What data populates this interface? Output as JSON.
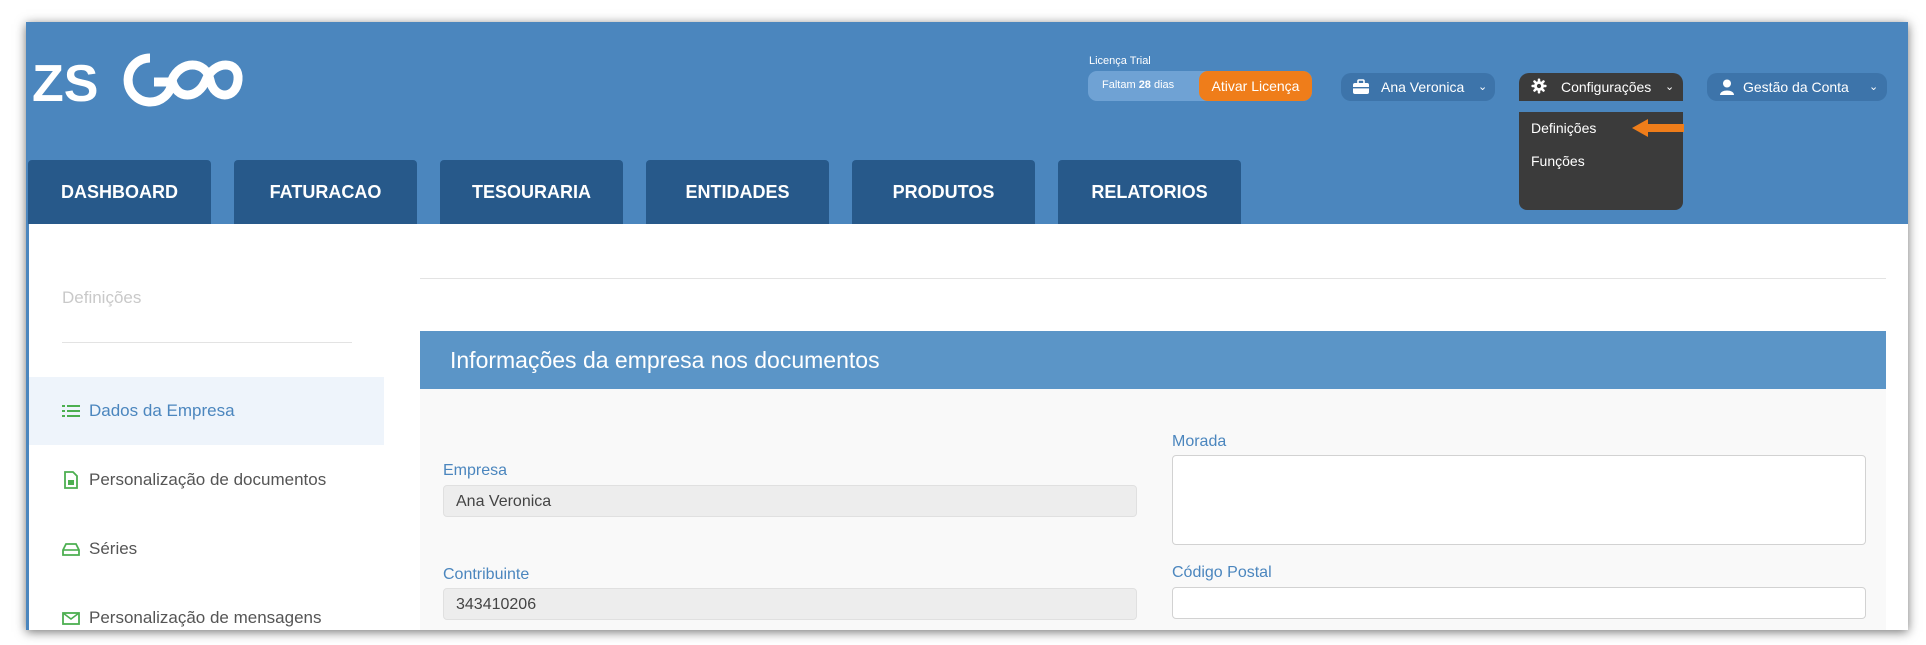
{
  "app": {
    "logo_text": "ZS GO",
    "license": {
      "label": "Licença Trial",
      "days_prefix": "Faltam",
      "days_value": "28",
      "days_suffix": "dias",
      "activate_button": "Ativar Licença"
    },
    "company_menu": {
      "label": "Ana Veronica",
      "icon": "briefcase-icon"
    },
    "config_menu": {
      "label": "Configurações",
      "icon": "gear-icon",
      "items": [
        "Definições",
        "Funções"
      ]
    },
    "account_menu": {
      "label": "Gestão da Conta",
      "icon": "user-icon"
    }
  },
  "nav": {
    "tabs": [
      "DASHBOARD",
      "FATURACAO",
      "TESOURARIA",
      "ENTIDADES",
      "PRODUTOS",
      "RELATORIOS"
    ]
  },
  "sidebar": {
    "title": "Definições",
    "items": [
      {
        "label": "Dados da Empresa",
        "icon": "list-icon",
        "active": true
      },
      {
        "label": "Personalização de documentos",
        "icon": "document-icon",
        "active": false
      },
      {
        "label": "Séries",
        "icon": "tray-icon",
        "active": false
      },
      {
        "label": "Personalização de mensagens",
        "icon": "envelope-icon",
        "active": false
      }
    ]
  },
  "panel": {
    "title": "Informações da empresa nos documentos",
    "fields": {
      "empresa": {
        "label": "Empresa",
        "value": "Ana Veronica"
      },
      "contribuinte": {
        "label": "Contribuinte",
        "value": "343410206"
      },
      "morada": {
        "label": "Morada",
        "value": ""
      },
      "codigo_postal": {
        "label": "Código Postal",
        "value": ""
      }
    }
  },
  "colors": {
    "header_bg": "#4b86be",
    "tab_bg": "#27598a",
    "accent_orange": "#ef7d1a",
    "panel_header": "#5b95c7",
    "dropdown_bg": "#3b3b3b"
  }
}
